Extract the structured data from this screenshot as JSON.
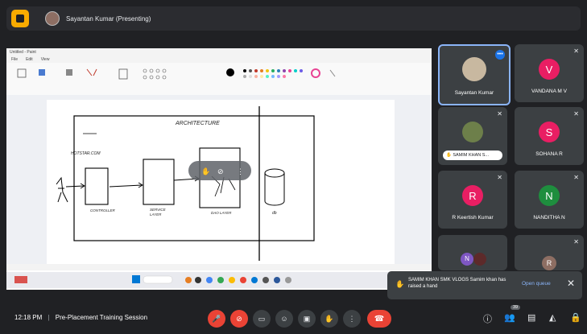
{
  "presentation": {
    "presenter_label": "Sayantan Kumar (Presenting)"
  },
  "paint": {
    "title": "Untitled - Paint",
    "menu": [
      "File",
      "Edit",
      "View"
    ],
    "canvas_title": "ARCHITECTURE",
    "labels": {
      "hotstar": "HOTSTAR.COM",
      "controller": "CONTROLLER",
      "service": "SERVICE LAYER",
      "dao": "DAO LAYER",
      "db": "db"
    }
  },
  "participants": [
    {
      "name": "Sayantan Kumar",
      "avatar": "photo"
    },
    {
      "name": "VANDANA M V",
      "initial": "V",
      "color": "#e91e63"
    },
    {
      "name": "SAMIM KHAN S...",
      "avatar": "photo"
    },
    {
      "name": "SOHANA R",
      "initial": "S",
      "color": "#e91e63"
    },
    {
      "name": "R Keertish Kumar",
      "initial": "R",
      "color": "#e91e63"
    },
    {
      "name": "NANDITHA N",
      "initial": "N",
      "color": "#1e8e3e"
    },
    {
      "name": "",
      "initial": "N",
      "color": "#7e57c2"
    },
    {
      "name": "",
      "initial": "R",
      "color": "#8d6e63"
    }
  ],
  "toast": {
    "message": "SAMIM KHAN SMK VLOGS Samim khan has raised a hand",
    "link": "Open queue"
  },
  "bottom": {
    "time_label": "12:18 PM",
    "separator": "|",
    "meeting_title": "Pre-Placement Training Session",
    "people_count": "39"
  },
  "colors": {
    "accent_red": "#ea4335",
    "meet_yellow": "#f9ab00",
    "tile_bg": "#3c4043"
  }
}
